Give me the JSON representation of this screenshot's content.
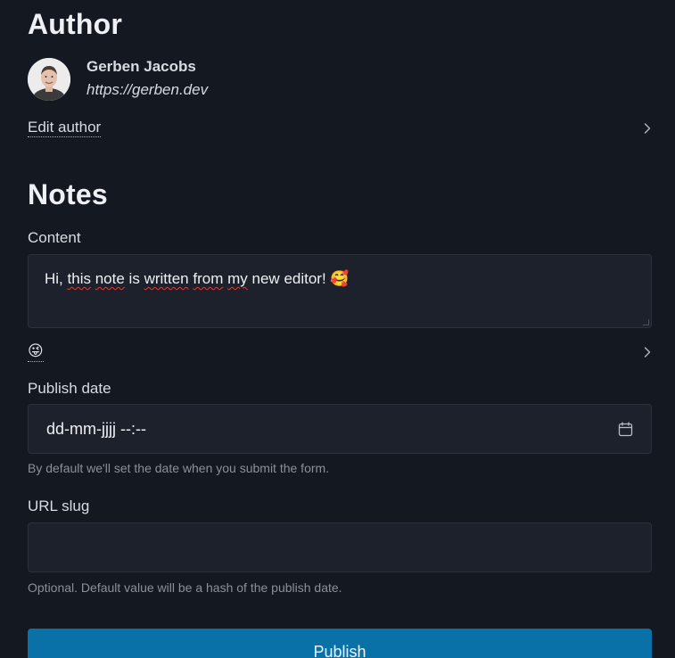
{
  "author": {
    "section_title": "Author",
    "name": "Gerben Jacobs",
    "url": "https://gerben.dev",
    "edit_label": "Edit author"
  },
  "notes": {
    "section_title": "Notes",
    "content": {
      "label": "Content",
      "value_words": [
        "Hi,",
        "this",
        "note",
        "is",
        "written",
        "from",
        "my",
        "new",
        "editor!"
      ],
      "value_emoji": "🥰"
    },
    "emoji_picker": {
      "current": "😜"
    },
    "publish_date": {
      "label": "Publish date",
      "placeholder": "dd-mm-jjjj --:--",
      "hint": "By default we'll set the date when you submit the form."
    },
    "url_slug": {
      "label": "URL slug",
      "value": "",
      "hint": "Optional. Default value will be a hash of the publish date."
    },
    "publish_label": "Publish"
  },
  "colors": {
    "background": "#141821",
    "field_background": "#1d212b",
    "primary_button": "#0a71a8"
  },
  "icons": {
    "chevron": "chevron-right-icon",
    "calendar": "calendar-icon"
  }
}
